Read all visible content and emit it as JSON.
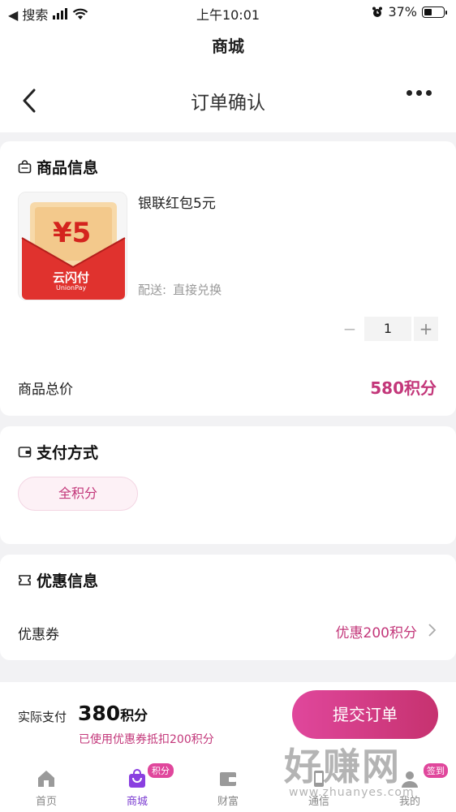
{
  "status_bar": {
    "back_app": "◀ 搜索",
    "time": "上午10:01",
    "battery": "37%"
  },
  "app_title": "商城",
  "nav": {
    "title": "订单确认"
  },
  "product_section": {
    "title": "商品信息",
    "product_name": "银联红包5元",
    "image_amount": "¥5",
    "image_brand": "云闪付",
    "image_brand_en": "UnionPay",
    "delivery_label": "配送:",
    "delivery_value": "直接兑换",
    "quantity": "1",
    "minus": "−",
    "plus": "+",
    "total_label": "商品总价",
    "total_value": "580积分"
  },
  "payment_section": {
    "title": "支付方式",
    "method": "全积分"
  },
  "discount_section": {
    "title": "优惠信息",
    "coupon_label": "优惠券",
    "coupon_value": "优惠200积分"
  },
  "bottom_bar": {
    "pay_label": "实际支付",
    "pay_amount": "380",
    "pay_unit": "积分",
    "discount_note": "已使用优惠券抵扣200积分",
    "submit_label": "提交订单"
  },
  "tabs": [
    {
      "label": "首页"
    },
    {
      "label": "商城",
      "badge": "积分"
    },
    {
      "label": "财富"
    },
    {
      "label": "通信"
    },
    {
      "label": "我的",
      "badge": "签到"
    }
  ],
  "watermark": {
    "text": "好赚网",
    "url": "www.zhuanyes.com"
  },
  "colors": {
    "accent": "#c3377a",
    "tab_active": "#7a3bd0",
    "background": "#f2f2f4"
  }
}
